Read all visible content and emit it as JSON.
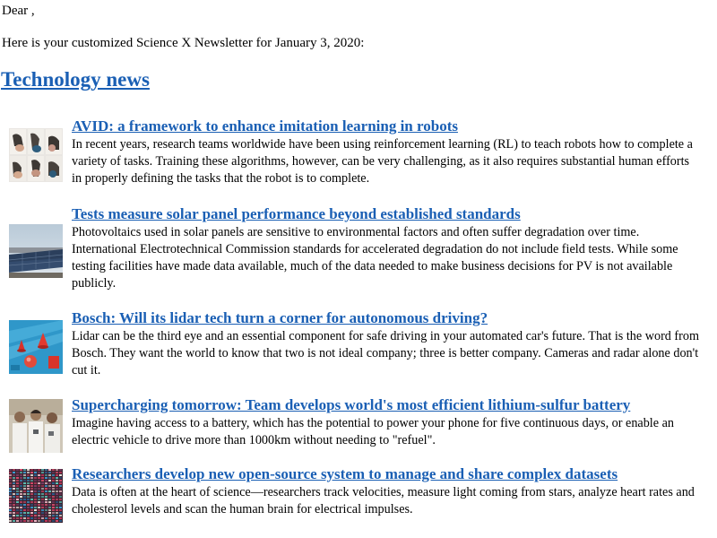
{
  "greeting": "Dear ,",
  "intro": "Here is your customized Science X Newsletter for January 3, 2020:",
  "section_title": "Technology news",
  "articles": [
    {
      "headline": "AVID: a framework to enhance imitation learning in robots",
      "summary": "In recent years, research teams worldwide have been using reinforcement learning (RL) to teach robots how to complete a variety of tasks. Training these algorithms, however, can be very challenging, as it also requires substantial human efforts in properly defining the tasks that the robot is to complete."
    },
    {
      "headline": "Tests measure solar panel performance beyond established standards",
      "summary": "Photovoltaics used in solar panels are sensitive to environmental factors and often suffer degradation over time. International Electrotechnical Commission standards for accelerated degradation do not include field tests. While some testing facilities have made data available, much of the data needed to make business decisions for PV is not available publicly."
    },
    {
      "headline": "Bosch: Will its lidar tech turn a corner for autonomous driving?",
      "summary": "Lidar can be the third eye and an essential component for safe driving in your automated car's future. That is the word from Bosch. They want the world to know that two is not ideal company; three is better company. Cameras and radar alone don't cut it."
    },
    {
      "headline": "Supercharging tomorrow: Team develops world's most efficient lithium-sulfur battery",
      "summary": "Imagine having access to a battery, which has the potential to power your phone for five continuous days, or enable an electric vehicle to drive more than 1000km without needing to \"refuel\"."
    },
    {
      "headline": "Researchers develop new open-source system to manage and share complex datasets",
      "summary": "Data is often at the heart of science—researchers track velocities, measure light coming from stars, analyze heart rates and cholesterol levels and scan the human brain for electrical impulses."
    }
  ],
  "colors": {
    "link": "#1a5fb4",
    "text": "#000000",
    "background": "#ffffff"
  }
}
